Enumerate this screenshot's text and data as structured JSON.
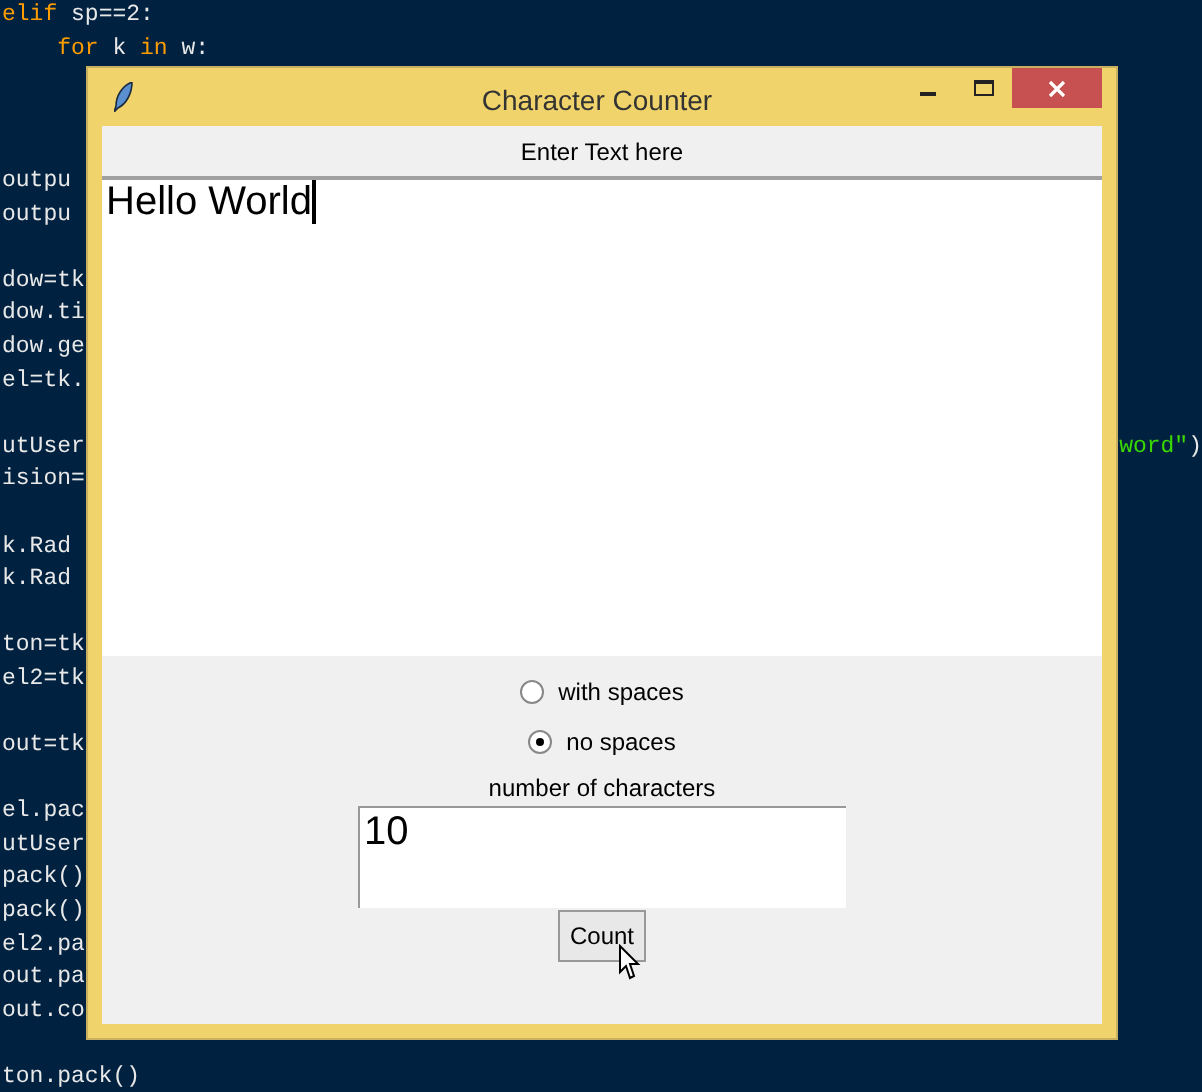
{
  "background_code": {
    "lines": [
      {
        "segments": [
          {
            "text": "elif",
            "kind": "keyword"
          },
          {
            "text": " sp==2:",
            "kind": "plain"
          }
        ]
      },
      {
        "segments": [
          {
            "text": "    for",
            "kind": "keyword"
          },
          {
            "text": " k ",
            "kind": "plain"
          },
          {
            "text": "in",
            "kind": "keyword"
          },
          {
            "text": " w:",
            "kind": "plain"
          }
        ]
      },
      {
        "blank": true
      },
      {
        "blank": true
      },
      {
        "blank": true
      },
      {
        "segments": [
          {
            "text": "outpu",
            "kind": "plain"
          }
        ]
      },
      {
        "segments": [
          {
            "text": "outpu",
            "kind": "plain"
          }
        ]
      },
      {
        "blank": true
      },
      {
        "segments": [
          {
            "text": "dow=tk",
            "kind": "plain"
          }
        ]
      },
      {
        "segments": [
          {
            "text": "dow.ti",
            "kind": "plain"
          }
        ]
      },
      {
        "segments": [
          {
            "text": "dow.ge",
            "kind": "plain"
          }
        ]
      },
      {
        "segments": [
          {
            "text": "el=tk.",
            "kind": "plain"
          }
        ]
      },
      {
        "blank": true
      },
      {
        "segments": [
          {
            "text": "utUser",
            "kind": "plain"
          }
        ],
        "tail": [
          {
            "text": "word\"",
            "kind": "string"
          },
          {
            "text": ")",
            "kind": "plain"
          }
        ]
      },
      {
        "segments": [
          {
            "text": "ision=",
            "kind": "plain"
          }
        ]
      },
      {
        "blank": true
      },
      {
        "segments": [
          {
            "text": "k.Rad",
            "kind": "plain"
          }
        ]
      },
      {
        "segments": [
          {
            "text": "k.Rad",
            "kind": "plain"
          }
        ]
      },
      {
        "blank": true
      },
      {
        "segments": [
          {
            "text": "ton=tk",
            "kind": "plain"
          }
        ]
      },
      {
        "segments": [
          {
            "text": "el2=tk",
            "kind": "plain"
          }
        ]
      },
      {
        "blank": true
      },
      {
        "segments": [
          {
            "text": "out=tk",
            "kind": "plain"
          }
        ]
      },
      {
        "blank": true
      },
      {
        "segments": [
          {
            "text": "el.pac",
            "kind": "plain"
          }
        ]
      },
      {
        "segments": [
          {
            "text": "utUser",
            "kind": "plain"
          }
        ]
      },
      {
        "segments": [
          {
            "text": "pack()",
            "kind": "plain"
          }
        ]
      },
      {
        "segments": [
          {
            "text": "pack()",
            "kind": "plain"
          }
        ]
      },
      {
        "segments": [
          {
            "text": "el2.pa",
            "kind": "plain"
          }
        ]
      },
      {
        "segments": [
          {
            "text": "out.pa",
            "kind": "plain"
          }
        ]
      },
      {
        "segments": [
          {
            "text": "out.co",
            "kind": "plain"
          }
        ]
      },
      {
        "blank": true
      },
      {
        "segments": [
          {
            "text": "ton.pack()",
            "kind": "plain"
          }
        ]
      }
    ]
  },
  "window": {
    "title": "Character Counter",
    "input_label": "Enter Text here",
    "text_value": "Hello World",
    "options": [
      {
        "label": "with spaces",
        "selected": false
      },
      {
        "label": "no spaces",
        "selected": true
      }
    ],
    "result_label": "number of characters",
    "result_value": "10",
    "button": "Count"
  }
}
